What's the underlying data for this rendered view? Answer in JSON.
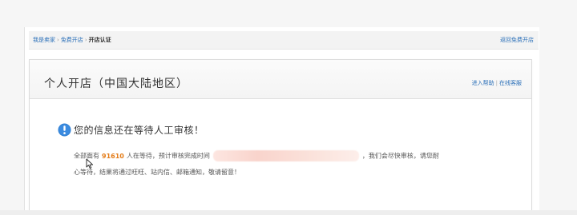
{
  "breadcrumb": {
    "items": [
      "我是卖家",
      "免费开店",
      "开店认证"
    ],
    "back_link": "返回免费开店"
  },
  "panel": {
    "title": "个人开店（中国大陆地区）",
    "links": [
      "进入帮助",
      "在线客服"
    ]
  },
  "notice": {
    "title": "您的信息还在等待人工审核！",
    "line1_prefix": "全部面有",
    "count": "91610",
    "line1_mid": "人在等待，预计审核完成时间",
    "line1_suffix": "，我们会尽快审核，请您耐",
    "line2": "心等待，结果将通过旺旺、站内信、邮箱通知，敬请留意！",
    "icon": "info-icon"
  },
  "colors": {
    "link": "#2a6fb8",
    "count": "#e47d1a",
    "icon": "#2f7fd2"
  }
}
